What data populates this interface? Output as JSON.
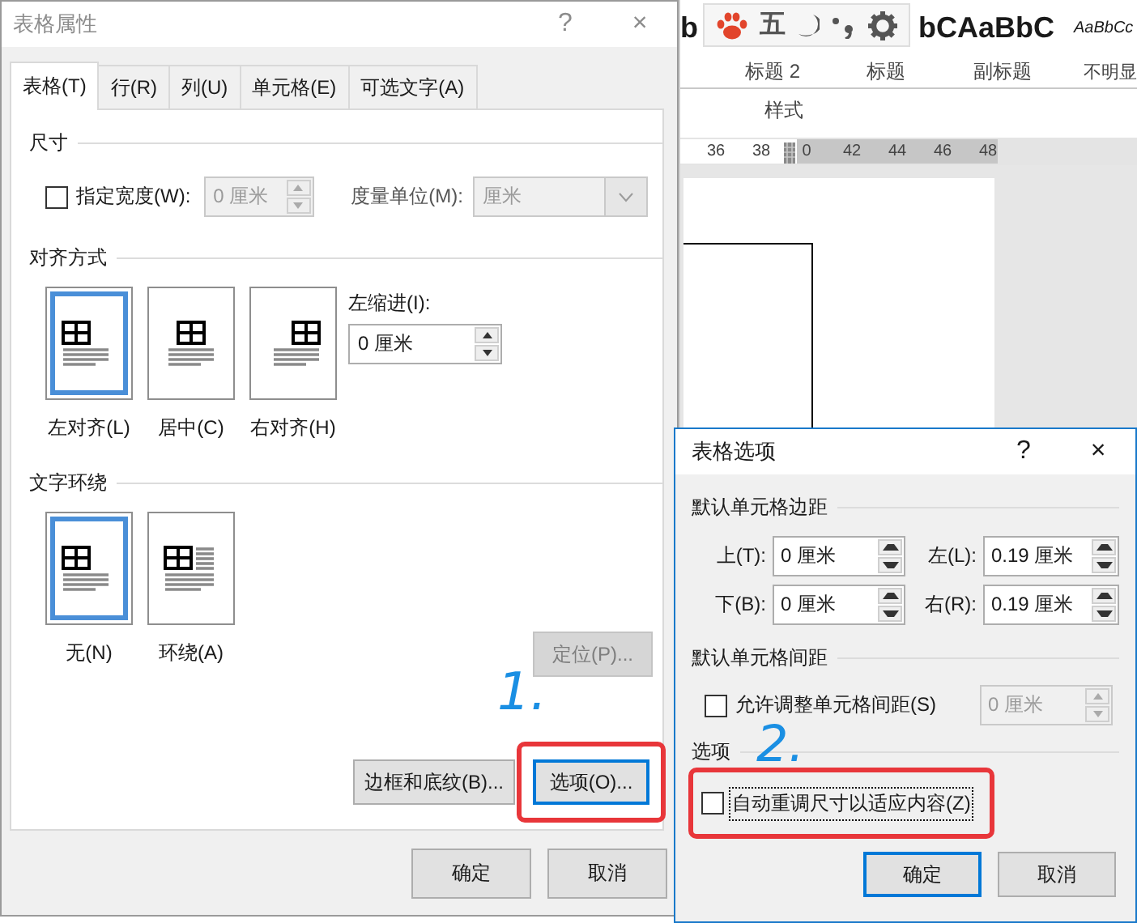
{
  "word_window": {
    "style_previews": [
      {
        "text": "b",
        "italic": false
      },
      {
        "text": "bC",
        "italic": false
      },
      {
        "text": "AaBbC",
        "italic": false
      },
      {
        "text": "AaBbCc",
        "italic": true
      }
    ],
    "style_names": [
      "标题 2",
      "标题",
      "副标题",
      "不明显"
    ],
    "group_label": "样式",
    "floating_toolbar": {
      "text_icon": "五"
    },
    "ruler_numbers": [
      "36",
      "38",
      "0",
      "42",
      "44",
      "46",
      "48"
    ]
  },
  "table_properties": {
    "title": "表格属性",
    "help": "?",
    "close": "×",
    "tabs": [
      {
        "label": "表格(T)",
        "selected": true
      },
      {
        "label": "行(R)",
        "selected": false
      },
      {
        "label": "列(U)",
        "selected": false
      },
      {
        "label": "单元格(E)",
        "selected": false
      },
      {
        "label": "可选文字(A)",
        "selected": false
      }
    ],
    "size": {
      "heading": "尺寸",
      "width_checkbox": {
        "label": "指定宽度(W):",
        "checked": false
      },
      "width_field": {
        "value": "0 厘米",
        "disabled": true
      },
      "unit_label": "度量单位(M):",
      "unit_select": {
        "value": "厘米",
        "disabled": true
      }
    },
    "alignment": {
      "heading": "对齐方式",
      "options": [
        {
          "kind": "left",
          "label": "左对齐(L)",
          "selected": true
        },
        {
          "kind": "center",
          "label": "居中(C)",
          "selected": false
        },
        {
          "kind": "right",
          "label": "右对齐(H)",
          "selected": false
        }
      ],
      "indent_label": "左缩进(I):",
      "indent_field": {
        "value": "0 厘米",
        "disabled": false
      }
    },
    "text_wrapping": {
      "heading": "文字环绕",
      "options": [
        {
          "kind": "none",
          "label": "无(N)",
          "selected": true
        },
        {
          "kind": "around",
          "label": "环绕(A)",
          "selected": false
        }
      ],
      "position_button": {
        "label": "定位(P)...",
        "disabled": true
      }
    },
    "borders_button": {
      "label": "边框和底纹(B)..."
    },
    "options_button": {
      "label": "选项(O)...",
      "focused": true,
      "highlighted": true
    },
    "annotation": "1.",
    "ok": "确定",
    "cancel": "取消"
  },
  "table_options": {
    "title": "表格选项",
    "help": "?",
    "close": "×",
    "margins_heading": "默认单元格边距",
    "margins": [
      {
        "label": "上(T):",
        "value": "0 厘米"
      },
      {
        "label": "左(L):",
        "value": "0.19 厘米"
      },
      {
        "label": "下(B):",
        "value": "0 厘米"
      },
      {
        "label": "右(R):",
        "value": "0.19 厘米"
      }
    ],
    "spacing_heading": "默认单元格间距",
    "spacing_checkbox": {
      "label": "允许调整单元格间距(S)",
      "checked": false
    },
    "spacing_field": {
      "value": "0 厘米",
      "disabled": true
    },
    "options_heading": "选项",
    "autofit_checkbox": {
      "label": "自动重调尺寸以适应内容(Z)",
      "checked": false,
      "focused": true,
      "highlighted": true
    },
    "annotation": "2.",
    "ok": {
      "label": "确定",
      "default": true
    },
    "cancel": {
      "label": "取消",
      "default": false
    }
  }
}
